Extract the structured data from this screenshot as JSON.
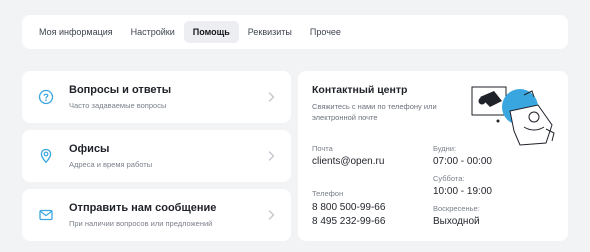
{
  "tabs": [
    "Моя информация",
    "Настройки",
    "Помощь",
    "Реквизиты",
    "Прочее"
  ],
  "active_tab": 2,
  "cards": [
    {
      "title": "Вопросы и ответы",
      "subtitle": "Часто задаваемые вопросы",
      "icon": "question-icon"
    },
    {
      "title": "Офисы",
      "subtitle": "Адреса и время работы",
      "icon": "location-pin-icon"
    },
    {
      "title": "Отправить нам сообщение",
      "subtitle": "При наличии вопросов или предложений",
      "icon": "envelope-icon"
    }
  ],
  "contact": {
    "title": "Контактный центр",
    "subtitle": "Свяжитесь с нами по телефону или электронной почте",
    "email_label": "Почта",
    "email": "clients@open.ru",
    "phone_label": "Телефон",
    "phones": [
      "8 800 500-99-66",
      "8 495 232-99-66"
    ],
    "hours": [
      {
        "label": "Будни:",
        "value": "07:00 - 00:00"
      },
      {
        "label": "Суббота:",
        "value": "10:00 - 19:00"
      },
      {
        "label": "Воскресенье:",
        "value": "Выходной"
      }
    ]
  },
  "colors": {
    "accent": "#3aa6df",
    "icon": "#3aa6df"
  }
}
